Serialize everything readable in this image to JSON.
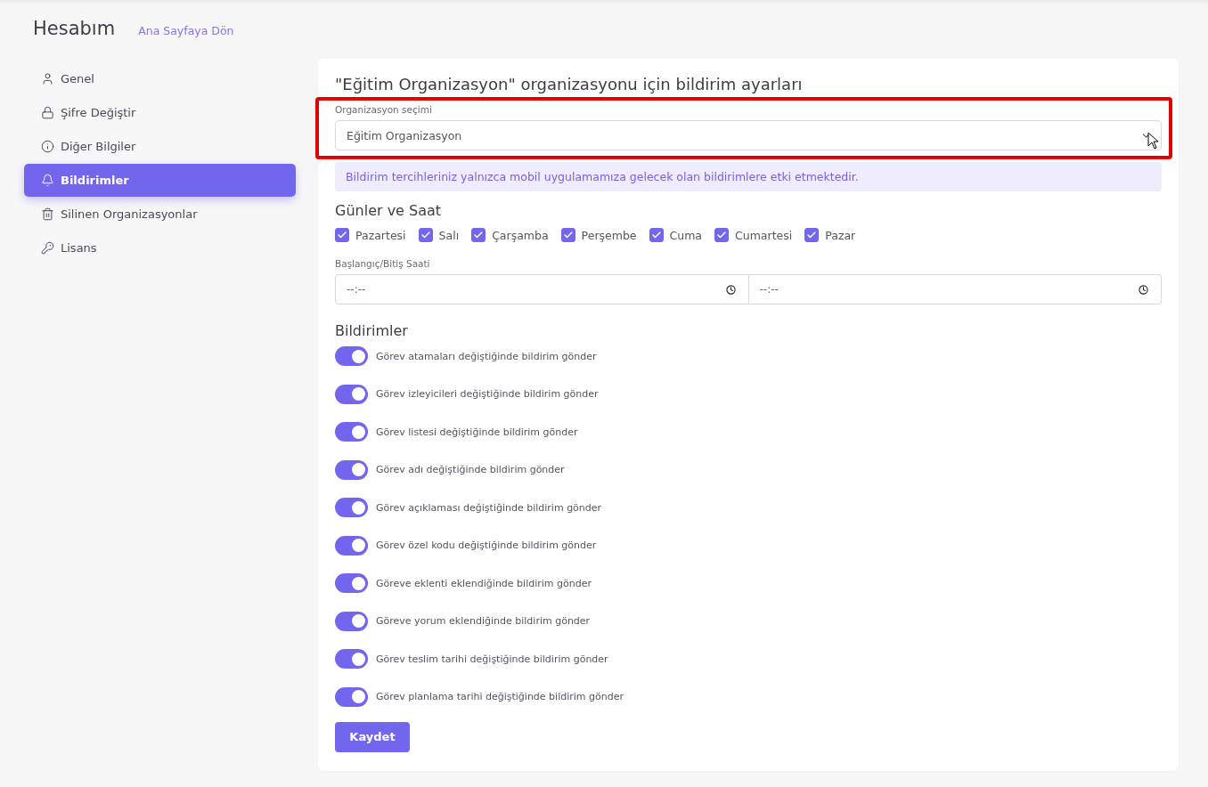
{
  "header": {
    "title": "Hesabım",
    "back_link": "Ana Sayfaya Dön"
  },
  "sidebar": {
    "items": [
      {
        "kind": "user",
        "label": "Genel",
        "selected": false
      },
      {
        "kind": "lock",
        "label": "Şifre Değiştir",
        "selected": false
      },
      {
        "kind": "info",
        "label": "Diğer Bilgiler",
        "selected": false
      },
      {
        "kind": "bell",
        "label": "Bildirimler",
        "selected": true
      },
      {
        "kind": "trash",
        "label": "Silinen Organizasyonlar",
        "selected": false
      },
      {
        "kind": "key",
        "label": "Lisans",
        "selected": false
      }
    ]
  },
  "panel": {
    "title": "\"Eğitim Organizasyon\" organizasyonu için bildirim ayarları",
    "organization_select": {
      "label": "Organizasyon seçimi",
      "value": "Eğitim Organizasyon",
      "highlighted": true
    },
    "notice": "Bildirim tercihleriniz yalnızca mobil uygulamamıza gelecek olan bildirimlere etki etmektedir.",
    "days_heading": "Günler ve Saat",
    "days": [
      {
        "label": "Pazartesi",
        "checked": true
      },
      {
        "label": "Salı",
        "checked": true
      },
      {
        "label": "Çarşamba",
        "checked": true
      },
      {
        "label": "Perşembe",
        "checked": true
      },
      {
        "label": "Cuma",
        "checked": true
      },
      {
        "label": "Cumartesi",
        "checked": true
      },
      {
        "label": "Pazar",
        "checked": true
      }
    ],
    "time_label": "Başlangıç/Bitiş Saati",
    "time_fields": [
      {
        "placeholder": "--:--"
      },
      {
        "placeholder": "--:--"
      }
    ],
    "notifications_heading": "Bildirimler",
    "notifications": [
      {
        "label": "Görev atamaları değiştiğinde bildirim gönder",
        "on": true
      },
      {
        "label": "Görev izleyicileri değiştiğinde bildirim gönder",
        "on": true
      },
      {
        "label": "Görev listesi değiştiğinde bildirim gönder",
        "on": true
      },
      {
        "label": "Görev adı değiştiğinde bildirim gönder",
        "on": true
      },
      {
        "label": "Görev açıklaması değiştiğinde bildirim gönder",
        "on": true
      },
      {
        "label": "Görev özel kodu değiştiğinde bildirim gönder",
        "on": true
      },
      {
        "label": "Göreve eklenti eklendiğinde bildirim gönder",
        "on": true
      },
      {
        "label": "Göreve yorum eklendiğinde bildirim gönder",
        "on": true
      },
      {
        "label": "Görev teslim tarihi değiştiğinde bildirim gönder",
        "on": true
      },
      {
        "label": "Görev planlama tarihi değiştiğinde bildirim gönder",
        "on": true
      }
    ],
    "save_button": "Kaydet"
  }
}
